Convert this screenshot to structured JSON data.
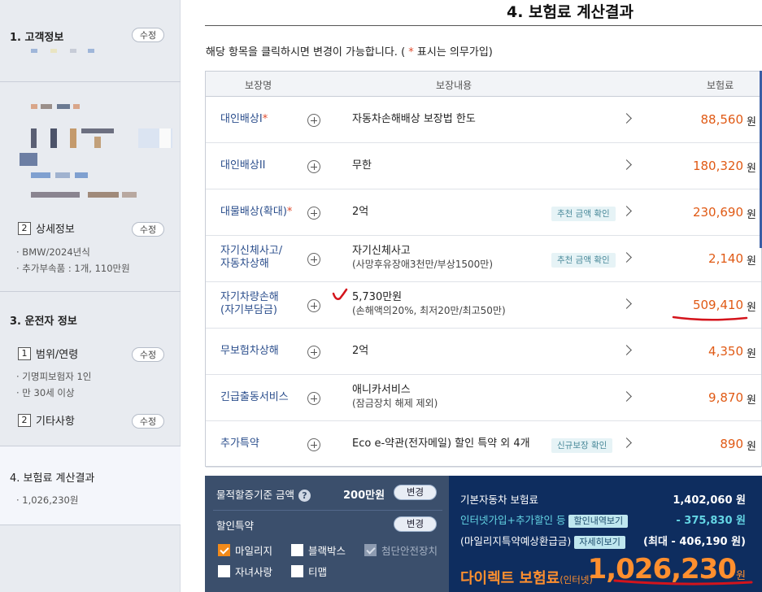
{
  "sidebar": {
    "section1": {
      "title": "1. 고객정보",
      "edit": "수정"
    },
    "section2": {
      "num": "2",
      "title": "상세정보",
      "edit": "수정",
      "items": [
        "· BMW/2024년식",
        "· 추가부속품 : 1개, 110만원"
      ]
    },
    "section3": {
      "title": "3. 운전자 정보"
    },
    "range": {
      "num": "1",
      "title": "범위/연령",
      "edit": "수정",
      "items": [
        "· 기명피보험자 1인",
        "· 만 30세 이상"
      ]
    },
    "other": {
      "num": "2",
      "title": "기타사항",
      "edit": "수정"
    },
    "section4": {
      "title": "4. 보험료 계산결과",
      "items": [
        "· 1,026,230원"
      ]
    }
  },
  "main": {
    "title": "4. 보험료 계산결과",
    "notice_pre": "해당 항목을 클릭하시면 변경이 가능합니다. (",
    "notice_star": " * ",
    "notice_post": "표시는 의무가입)",
    "headers": {
      "name": "보장명",
      "content": "보장내용",
      "premium": "보험료"
    },
    "won": "원",
    "rows": [
      {
        "name": "대인배상I",
        "required": "*",
        "desc": "자동차손해배상 보장법 한도",
        "desc2": "",
        "tag": "",
        "price": "88,560"
      },
      {
        "name": "대인배상II",
        "required": "",
        "desc": "무한",
        "desc2": "",
        "tag": "",
        "price": "180,320"
      },
      {
        "name": "대물배상(확대)",
        "required": "*",
        "desc": "2억",
        "desc2": "",
        "tag": "추천 금액 확인",
        "price": "230,690"
      },
      {
        "name": "자기신체사고/",
        "name2": "자동차상해",
        "required": "",
        "desc": "자기신체사고",
        "desc2": "(사망후유장애3천만/부상1500만)",
        "tag": "추천 금액 확인",
        "price": "2,140"
      },
      {
        "name": "자기차량손해",
        "name2": "(자기부담금)",
        "required": "",
        "desc": "5,730만원",
        "desc2": "(손해액의20%, 최저20만/최고50만)",
        "tag": "",
        "price": "509,410"
      },
      {
        "name": "무보험차상해",
        "required": "",
        "desc": "2억",
        "desc2": "",
        "tag": "",
        "price": "4,350"
      },
      {
        "name": "긴급출동서비스",
        "required": "",
        "desc": "애니카서비스",
        "desc2": "(잠금장치 해제 제외)",
        "tag": "",
        "price": "9,870"
      },
      {
        "name": "추가특약",
        "required": "",
        "desc": "Eco e-약관(전자메일) 할인 특약 외 4개",
        "desc2": "",
        "tag": "신규보장 확인",
        "price": "890"
      }
    ]
  },
  "discount": {
    "property_label": "물적할증기준 금액",
    "property_value": "200만원",
    "change": "변경",
    "special_label": "할인특약",
    "checks": [
      {
        "label": "마일리지",
        "state": "checked"
      },
      {
        "label": "블랙박스",
        "state": "unchecked"
      },
      {
        "label": "첨단안전장치",
        "state": "disabled"
      },
      {
        "label": "자녀사랑",
        "state": "unchecked"
      },
      {
        "label": "티맵",
        "state": "unchecked"
      }
    ]
  },
  "summary": {
    "base_label": "기본자동차 보험료",
    "base_value": "1,402,060 원",
    "internet_label": "인터넷가입+추가할인 등",
    "internet_chip": "할인내역보기",
    "internet_value": "- 375,830 원",
    "mileage_label": "(마일리지특약예상환급금)",
    "mileage_chip": "자세히보기",
    "mileage_value": "(최대 - 406,190 원)",
    "direct_label": "다이렉트 보험료",
    "direct_sub": "(인터넷)",
    "total": "1,026,230",
    "total_won": "원"
  },
  "colors": {
    "accent_orange": "#e05a15",
    "navy": "#0e2d5f",
    "link_blue": "#2b4e8c",
    "annotation_red": "#d4141c"
  }
}
